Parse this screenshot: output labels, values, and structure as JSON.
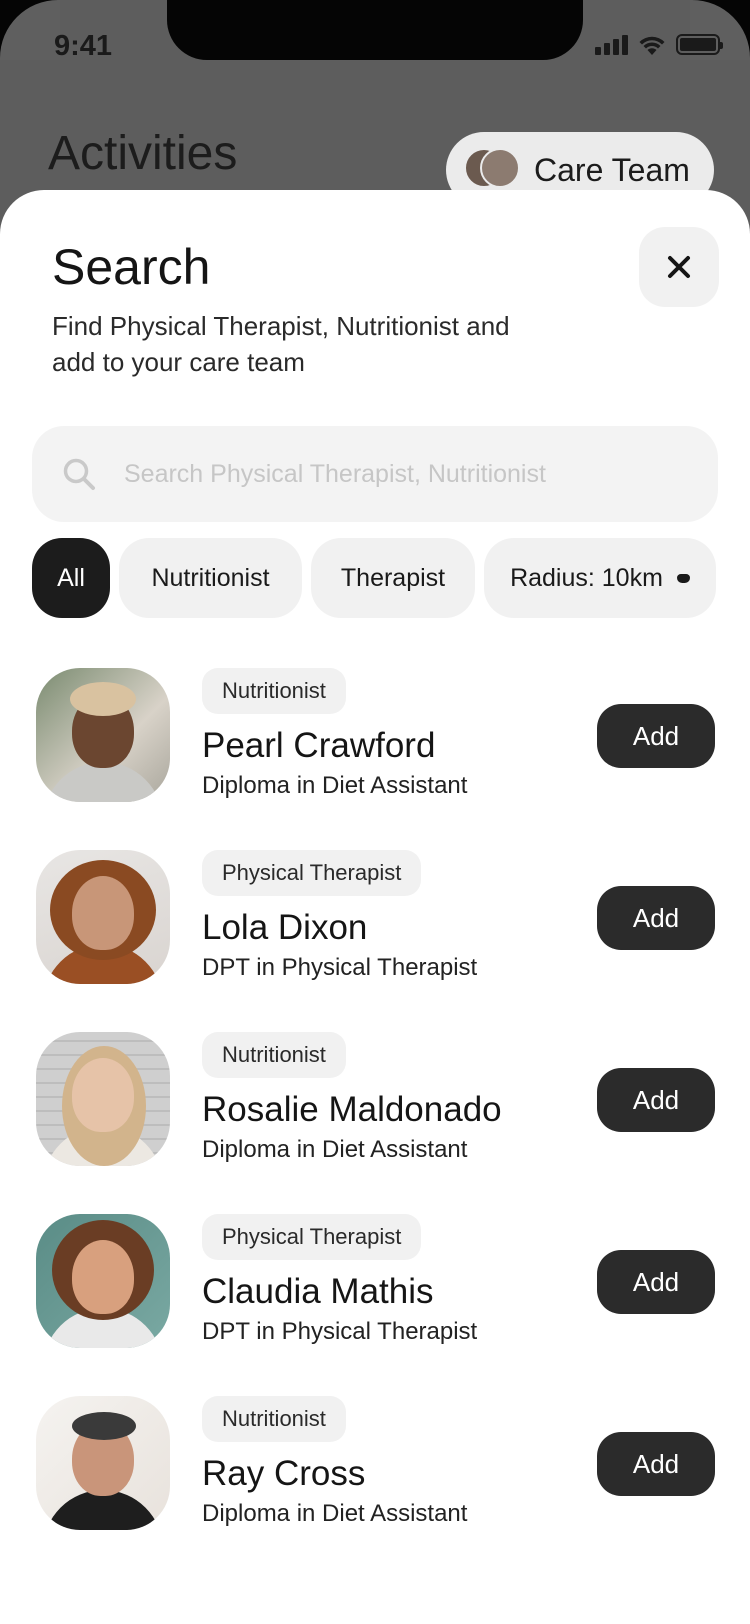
{
  "status_bar": {
    "time": "9:41"
  },
  "background": {
    "title": "Activities",
    "care_team_label": "Care Team"
  },
  "sheet": {
    "title": "Search",
    "subtitle": "Find Physical Therapist, Nutritionist and add to your care team",
    "close_icon": "close-icon"
  },
  "search": {
    "placeholder": "Search Physical Therapist, Nutritionist",
    "value": ""
  },
  "filters": {
    "all": "All",
    "nutritionist": "Nutritionist",
    "therapist": "Therapist",
    "radius": "Radius: 10km"
  },
  "people": [
    {
      "role": "Nutritionist",
      "name": "Pearl Crawford",
      "degree": "Diploma in Diet Assistant",
      "action": "Add"
    },
    {
      "role": "Physical Therapist",
      "name": "Lola Dixon",
      "degree": "DPT in Physical Therapist",
      "action": "Add"
    },
    {
      "role": "Nutritionist",
      "name": "Rosalie Maldonado",
      "degree": "Diploma in Diet Assistant",
      "action": "Add"
    },
    {
      "role": "Physical Therapist",
      "name": "Claudia Mathis",
      "degree": "DPT in Physical Therapist",
      "action": "Add"
    },
    {
      "role": "Nutritionist",
      "name": "Ray Cross",
      "degree": "Diploma in Diet Assistant",
      "action": "Add"
    }
  ],
  "colors": {
    "primary_dark": "#1c1c1c",
    "chip_bg": "#f1f1f1",
    "button_bg": "#2b2b2b",
    "overlay": "#5f5f5f"
  }
}
